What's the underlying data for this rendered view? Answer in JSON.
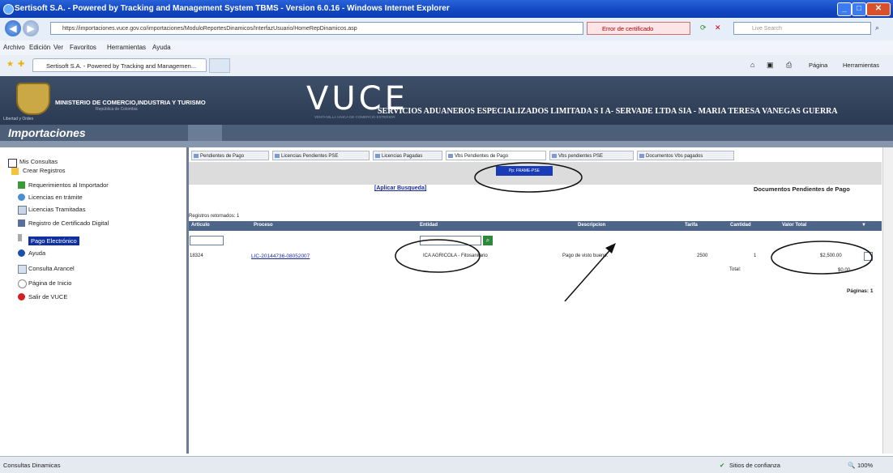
{
  "browser": {
    "title": "Sertisoft S.A. - Powered by Tracking and Management System TBMS - Version 6.0.16 - Windows Internet Explorer",
    "url": "https://importaciones.vuce.gov.co/importaciones/ModuloReportesDinamicos/InterfazUsuario/HomeRepDinamicos.asp",
    "cert_error": "Error de certificado",
    "search_placeholder": "Live Search",
    "menu": [
      "Archivo",
      "Edición",
      "Ver",
      "Favoritos",
      "Herramientas",
      "Ayuda"
    ],
    "tab_title": "Sertisoft S.A. - Powered by Tracking and Managemen...",
    "toolbar": {
      "pagina": "Página",
      "herramientas": "Herramientas"
    }
  },
  "header": {
    "ministry": "MINISTERIO DE COMERCIO,INDUSTRIA Y TURISMO",
    "republic": "República de Colombia",
    "motto": "Libertad y Orden",
    "logo_text": "VUCE",
    "ventanilla": "VENTANILLA UNICA DE COMERCIO EXTERIOR",
    "company": "SERVICIOS ADUANEROS ESPECIALIZADOS LIMITADA S I A- SERVADE LTDA SIA - MARIA TERESA VANEGAS GUERRA",
    "section": "Importaciones"
  },
  "sidebar": {
    "items": [
      {
        "label": "Mis Consultas"
      },
      {
        "label": "Crear Registros"
      },
      {
        "label": "Requerimientos al Importador"
      },
      {
        "label": "Licencias en trámite"
      },
      {
        "label": "Licencias Tramitadas"
      },
      {
        "label": "Registro de Certificado Digital"
      },
      {
        "label": "Pago Electrónico"
      },
      {
        "label": "Ayuda"
      },
      {
        "label": "Consulta Arancel"
      },
      {
        "label": "Página de Inicio"
      },
      {
        "label": "Salir de VUCE"
      }
    ]
  },
  "tabs": [
    "Pendientes de Pago",
    "Licencias Pendientes PSE",
    "Licencias Pagadas",
    "Vbs Pendientes de Pago",
    "Vbs pendientes PSE",
    "Documentos Vbs pagados"
  ],
  "pay_frame_label": "Pp: FRAME-PSE",
  "aplicar_busqueda": "[Aplicar Busqueda]",
  "docs_title": "Documentos Pendientes de Pago",
  "registros": "Registros retornados: 1",
  "table": {
    "columns": [
      "Articulo",
      "Proceso",
      "Entidad",
      "Descripcion",
      "Tarifa",
      "Cantidad",
      "Valor Total"
    ],
    "row": {
      "articulo": "18324",
      "proceso": "LIC-20144736-08052007",
      "entidad": "ICA AGRICOLA - Fitosanitario",
      "descripcion": "Pago de visto bueno.",
      "tarifa": "2500",
      "cantidad": "1",
      "valor_total": "$2,500.00"
    },
    "total_label": "Total:",
    "total_value": "$0.00",
    "paginas": "Páginas: 1"
  },
  "status": {
    "left": "Consultas Dinamicas",
    "zone": "Sitios de confianza",
    "zoom": "100%"
  }
}
